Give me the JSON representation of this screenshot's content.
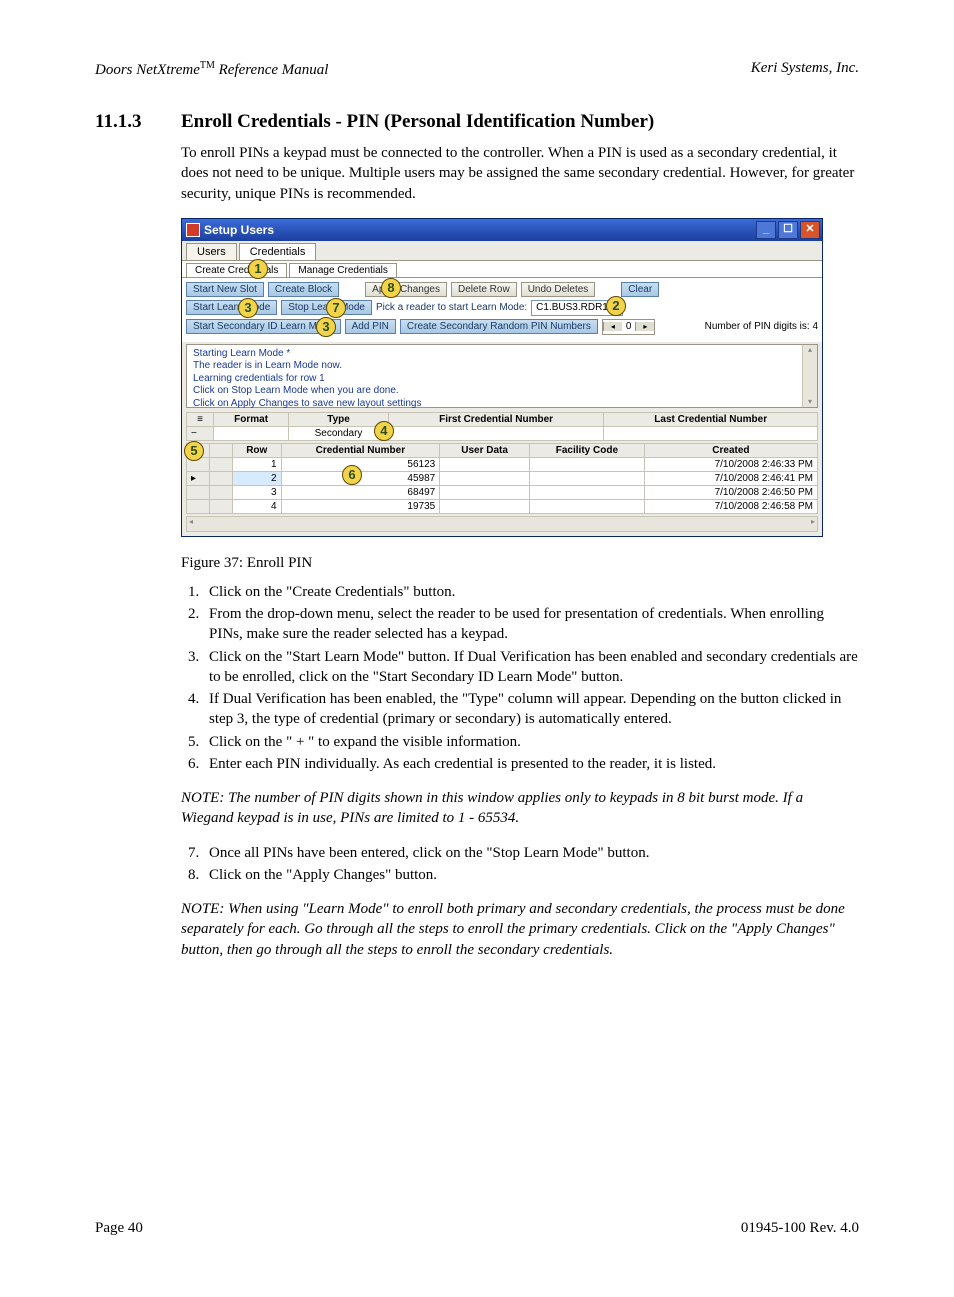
{
  "header": {
    "product": "Doors NetXtreme",
    "tm": "TM",
    "doc": " Reference Manual",
    "company": "Keri Systems, Inc."
  },
  "section": {
    "number": "11.1.3",
    "title": "Enroll Credentials - PIN (Personal Identification Number)"
  },
  "intro": "To enroll PINs a keypad must be connected to the controller. When a PIN is used as a secondary credential, it does not need to be unique. Multiple users may be assigned the same secondary credential. However, for greater security, unique PINs is recommended.",
  "window": {
    "title": "Setup Users",
    "tabs": {
      "users": "Users",
      "credentials": "Credentials"
    },
    "subtabs": {
      "create": "Create Credentials",
      "manage": "Manage Credentials"
    },
    "buttons": {
      "start_new_slot": "Start New Slot",
      "create_block": "Create Block",
      "apply_changes": "Apply Changes",
      "delete_row": "Delete Row",
      "undo_deletes": "Undo Deletes",
      "clear": "Clear",
      "start_learn": "Start Learn Mode",
      "stop_learn": "Stop Learn Mode",
      "start_sec_learn": "Start Secondary ID Learn Mode",
      "add_pin": "Add PIN",
      "create_sec_random": "Create Secondary Random PIN Numbers"
    },
    "labels": {
      "pick_reader": "Pick a reader to start Learn Mode:",
      "reader_value": "C1.BUS3.RDR1",
      "pin_digits": "Number of PIN digits is:  4"
    },
    "spinner_value": "0",
    "messages": {
      "l1": "Starting Learn Mode *",
      "l2": "The reader is in Learn Mode now.",
      "l3": "Learning credentials for row 1",
      "l4": "Click on Stop Learn Mode when you are done.",
      "l5": "Click on Apply Changes to save new layout settings"
    },
    "grid1": {
      "h_format": "Format",
      "h_type": "Type",
      "h_first": "First Credential Number",
      "h_last": "Last Credential Number",
      "type_value": "Secondary"
    },
    "grid2": {
      "h_row": "Row",
      "h_cred": "Credential Number",
      "h_user": "User Data",
      "h_fac": "Facility Code",
      "h_created": "Created",
      "rows": [
        {
          "n": "1",
          "cred": "56123",
          "created": "7/10/2008 2:46:33 PM"
        },
        {
          "n": "2",
          "cred": "45987",
          "created": "7/10/2008 2:46:41 PM"
        },
        {
          "n": "3",
          "cred": "68497",
          "created": "7/10/2008 2:46:50 PM"
        },
        {
          "n": "4",
          "cred": "19735",
          "created": "7/10/2008 2:46:58 PM"
        }
      ]
    },
    "callouts": {
      "c1": "1",
      "c2": "2",
      "c3a": "3",
      "c3b": "3",
      "c4": "4",
      "c5": "5",
      "c6": "6",
      "c7": "7",
      "c8": "8"
    }
  },
  "figure_caption": "Figure 37: Enroll PIN",
  "steps_a": [
    "Click on the \"Create Credentials\" button.",
    "From the drop-down menu, select the reader to be used for presentation of credentials. When enrolling PINs, make sure the reader selected has a keypad.",
    "Click on the \"Start Learn Mode\" button. If Dual Verification has been enabled and secondary credentials are to be enrolled, click on the \"Start Secondary ID Learn Mode\" button.",
    "If Dual Verification has been enabled, the \"Type\" column will appear. Depending on the button clicked in step 3, the type of credential (primary or secondary) is automatically entered.",
    "Click on the \" + \" to expand the visible information.",
    "Enter each PIN individually. As each credential is presented to the reader, it is listed."
  ],
  "note1": "NOTE: The number of PIN digits shown in this window applies only to keypads in 8 bit burst mode. If a Wiegand keypad is in use, PINs are limited to 1 - 65534.",
  "steps_b": [
    "Once all PINs have been entered, click on the \"Stop Learn Mode\" button.",
    "Click on the \"Apply Changes\" button."
  ],
  "note2": "NOTE: When using \"Learn Mode\" to enroll both primary and secondary credentials, the process must be done separately for each. Go through all the steps to enroll the primary credentials. Click on the \"Apply Changes\" button, then go through all the steps to enroll the secondary credentials.",
  "footer": {
    "page": "Page 40",
    "rev": "01945-100  Rev. 4.0"
  }
}
